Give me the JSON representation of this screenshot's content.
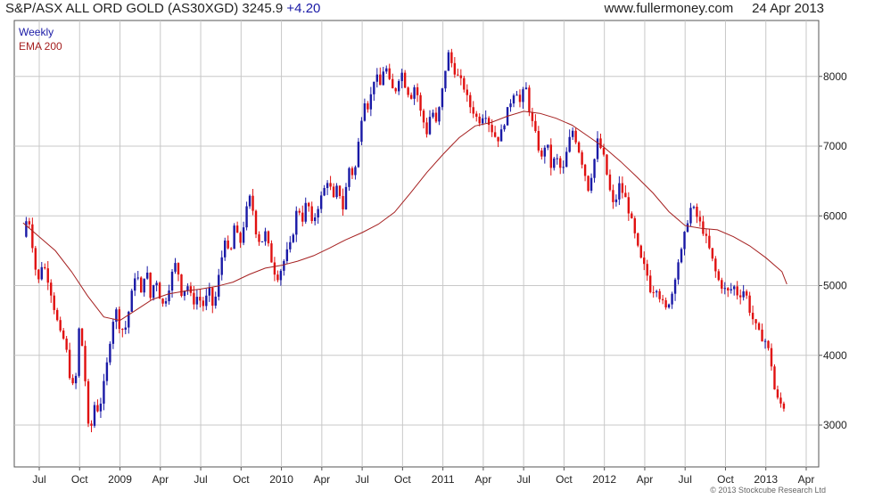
{
  "header": {
    "title": "S&P/ASX ALL ORD GOLD (AS30XGD) 3245.9",
    "change": "+4.20",
    "site": "www.fullermoney.com",
    "date": "24 Apr 2013"
  },
  "copyright": "© 2013 Stockcube Research Ltd",
  "colors": {
    "up": "#1a1aa6",
    "down": "#e01010",
    "ema": "#a52020",
    "grid": "#c8c8c8",
    "axis": "#555555"
  },
  "chart_data": {
    "type": "candlestick",
    "ylim": [
      2550,
      8550
    ],
    "yticks": [
      3000,
      4000,
      5000,
      6000,
      7000,
      8000
    ],
    "legend": [
      "Weekly",
      "EMA 200"
    ],
    "legend_position": "top-left",
    "grid": true,
    "xticks": [
      {
        "label": "Jul",
        "x": 2008.5
      },
      {
        "label": "Oct",
        "x": 2008.75
      },
      {
        "label": "2009",
        "x": 2009.0
      },
      {
        "label": "Apr",
        "x": 2009.25
      },
      {
        "label": "Jul",
        "x": 2009.5
      },
      {
        "label": "Oct",
        "x": 2009.75
      },
      {
        "label": "2010",
        "x": 2010.0
      },
      {
        "label": "Apr",
        "x": 2010.25
      },
      {
        "label": "Jul",
        "x": 2010.5
      },
      {
        "label": "Oct",
        "x": 2010.75
      },
      {
        "label": "2011",
        "x": 2011.0
      },
      {
        "label": "Apr",
        "x": 2011.25
      },
      {
        "label": "Jul",
        "x": 2011.5
      },
      {
        "label": "Oct",
        "x": 2011.75
      },
      {
        "label": "2012",
        "x": 2012.0
      },
      {
        "label": "Apr",
        "x": 2012.25
      },
      {
        "label": "Jul",
        "x": 2012.5
      },
      {
        "label": "Oct",
        "x": 2012.75
      },
      {
        "label": "2013",
        "x": 2013.0
      },
      {
        "label": "Apr",
        "x": 2013.25
      }
    ],
    "price_path": [
      [
        2008.4,
        5700
      ],
      [
        2008.43,
        6050
      ],
      [
        2008.46,
        5550
      ],
      [
        2008.49,
        5000
      ],
      [
        2008.52,
        5350
      ],
      [
        2008.56,
        5050
      ],
      [
        2008.6,
        4600
      ],
      [
        2008.63,
        4300
      ],
      [
        2008.66,
        4200
      ],
      [
        2008.69,
        3700
      ],
      [
        2008.72,
        3450
      ],
      [
        2008.75,
        4500
      ],
      [
        2008.78,
        3800
      ],
      [
        2008.81,
        2750
      ],
      [
        2008.84,
        3300
      ],
      [
        2008.87,
        3200
      ],
      [
        2008.91,
        3700
      ],
      [
        2008.94,
        4250
      ],
      [
        2008.97,
        4700
      ],
      [
        2009.0,
        4400
      ],
      [
        2009.03,
        4350
      ],
      [
        2009.06,
        4700
      ],
      [
        2009.1,
        5250
      ],
      [
        2009.13,
        4850
      ],
      [
        2009.16,
        5300
      ],
      [
        2009.19,
        4800
      ],
      [
        2009.22,
        5150
      ],
      [
        2009.26,
        4700
      ],
      [
        2009.29,
        4850
      ],
      [
        2009.32,
        5150
      ],
      [
        2009.35,
        5350
      ],
      [
        2009.38,
        4900
      ],
      [
        2009.42,
        5000
      ],
      [
        2009.45,
        4750
      ],
      [
        2009.48,
        4850
      ],
      [
        2009.52,
        4700
      ],
      [
        2009.55,
        4950
      ],
      [
        2009.58,
        4650
      ],
      [
        2009.62,
        5250
      ],
      [
        2009.65,
        5700
      ],
      [
        2009.68,
        5350
      ],
      [
        2009.71,
        5900
      ],
      [
        2009.74,
        5550
      ],
      [
        2009.78,
        6050
      ],
      [
        2009.81,
        6300
      ],
      [
        2009.84,
        5800
      ],
      [
        2009.87,
        5600
      ],
      [
        2009.9,
        5750
      ],
      [
        2009.94,
        5350
      ],
      [
        2009.97,
        5100
      ],
      [
        2010.0,
        5250
      ],
      [
        2010.03,
        5450
      ],
      [
        2010.06,
        5600
      ],
      [
        2010.1,
        6150
      ],
      [
        2010.13,
        5950
      ],
      [
        2010.16,
        6250
      ],
      [
        2010.19,
        5850
      ],
      [
        2010.22,
        6100
      ],
      [
        2010.26,
        6350
      ],
      [
        2010.29,
        6550
      ],
      [
        2010.32,
        6200
      ],
      [
        2010.35,
        6450
      ],
      [
        2010.38,
        6100
      ],
      [
        2010.42,
        6700
      ],
      [
        2010.45,
        6550
      ],
      [
        2010.48,
        7100
      ],
      [
        2010.51,
        7700
      ],
      [
        2010.54,
        7550
      ],
      [
        2010.58,
        8050
      ],
      [
        2010.61,
        7850
      ],
      [
        2010.64,
        8200
      ],
      [
        2010.67,
        7900
      ],
      [
        2010.7,
        7750
      ],
      [
        2010.74,
        8100
      ],
      [
        2010.77,
        7850
      ],
      [
        2010.8,
        7700
      ],
      [
        2010.83,
        7900
      ],
      [
        2010.86,
        7500
      ],
      [
        2010.9,
        7200
      ],
      [
        2010.93,
        7550
      ],
      [
        2010.96,
        7300
      ],
      [
        2011.0,
        7850
      ],
      [
        2011.03,
        8350
      ],
      [
        2011.06,
        8150
      ],
      [
        2011.09,
        8000
      ],
      [
        2011.13,
        7850
      ],
      [
        2011.16,
        7600
      ],
      [
        2011.19,
        7500
      ],
      [
        2011.22,
        7350
      ],
      [
        2011.26,
        7500
      ],
      [
        2011.29,
        7300
      ],
      [
        2011.32,
        7150
      ],
      [
        2011.35,
        7100
      ],
      [
        2011.38,
        7350
      ],
      [
        2011.42,
        7650
      ],
      [
        2011.45,
        7850
      ],
      [
        2011.48,
        7600
      ],
      [
        2011.51,
        7900
      ],
      [
        2011.54,
        7450
      ],
      [
        2011.58,
        7100
      ],
      [
        2011.61,
        6800
      ],
      [
        2011.64,
        7100
      ],
      [
        2011.67,
        6700
      ],
      [
        2011.7,
        6850
      ],
      [
        2011.74,
        6600
      ],
      [
        2011.77,
        6950
      ],
      [
        2011.8,
        7250
      ],
      [
        2011.83,
        7050
      ],
      [
        2011.87,
        6700
      ],
      [
        2011.9,
        6400
      ],
      [
        2011.93,
        6700
      ],
      [
        2011.96,
        7100
      ],
      [
        2012.0,
        6800
      ],
      [
        2012.03,
        6400
      ],
      [
        2012.06,
        6100
      ],
      [
        2012.09,
        6450
      ],
      [
        2012.13,
        6250
      ],
      [
        2012.16,
        6000
      ],
      [
        2012.19,
        5700
      ],
      [
        2012.22,
        5400
      ],
      [
        2012.26,
        5200
      ],
      [
        2012.29,
        4900
      ],
      [
        2012.32,
        5000
      ],
      [
        2012.35,
        4800
      ],
      [
        2012.38,
        4650
      ],
      [
        2012.42,
        4900
      ],
      [
        2012.45,
        5300
      ],
      [
        2012.48,
        5500
      ],
      [
        2012.51,
        5900
      ],
      [
        2012.54,
        6150
      ],
      [
        2012.58,
        5950
      ],
      [
        2012.61,
        5800
      ],
      [
        2012.64,
        5600
      ],
      [
        2012.67,
        5350
      ],
      [
        2012.7,
        5100
      ],
      [
        2012.74,
        4950
      ],
      [
        2012.77,
        4900
      ],
      [
        2012.8,
        5000
      ],
      [
        2012.83,
        4850
      ],
      [
        2012.87,
        4950
      ],
      [
        2012.9,
        4650
      ],
      [
        2012.93,
        4450
      ],
      [
        2012.96,
        4300
      ],
      [
        2013.0,
        4200
      ],
      [
        2013.03,
        3950
      ],
      [
        2013.06,
        3400
      ],
      [
        2013.1,
        3280
      ],
      [
        2013.13,
        3245
      ]
    ],
    "ema200": [
      [
        2008.4,
        5900
      ],
      [
        2008.5,
        5700
      ],
      [
        2008.6,
        5500
      ],
      [
        2008.7,
        5200
      ],
      [
        2008.8,
        4850
      ],
      [
        2008.9,
        4550
      ],
      [
        2009.0,
        4500
      ],
      [
        2009.1,
        4650
      ],
      [
        2009.2,
        4800
      ],
      [
        2009.3,
        4880
      ],
      [
        2009.4,
        4920
      ],
      [
        2009.5,
        4950
      ],
      [
        2009.6,
        4990
      ],
      [
        2009.7,
        5050
      ],
      [
        2009.8,
        5160
      ],
      [
        2009.9,
        5250
      ],
      [
        2010.0,
        5290
      ],
      [
        2010.1,
        5350
      ],
      [
        2010.2,
        5430
      ],
      [
        2010.3,
        5540
      ],
      [
        2010.4,
        5660
      ],
      [
        2010.5,
        5760
      ],
      [
        2010.6,
        5880
      ],
      [
        2010.7,
        6050
      ],
      [
        2010.8,
        6330
      ],
      [
        2010.9,
        6620
      ],
      [
        2011.0,
        6880
      ],
      [
        2011.1,
        7120
      ],
      [
        2011.2,
        7290
      ],
      [
        2011.3,
        7340
      ],
      [
        2011.4,
        7430
      ],
      [
        2011.5,
        7500
      ],
      [
        2011.6,
        7470
      ],
      [
        2011.7,
        7400
      ],
      [
        2011.8,
        7300
      ],
      [
        2011.9,
        7140
      ],
      [
        2012.0,
        6980
      ],
      [
        2012.1,
        6780
      ],
      [
        2012.2,
        6560
      ],
      [
        2012.3,
        6330
      ],
      [
        2012.4,
        6060
      ],
      [
        2012.5,
        5860
      ],
      [
        2012.6,
        5820
      ],
      [
        2012.7,
        5800
      ],
      [
        2012.8,
        5700
      ],
      [
        2012.9,
        5570
      ],
      [
        2013.0,
        5400
      ],
      [
        2013.1,
        5200
      ],
      [
        2013.13,
        5020
      ]
    ]
  }
}
